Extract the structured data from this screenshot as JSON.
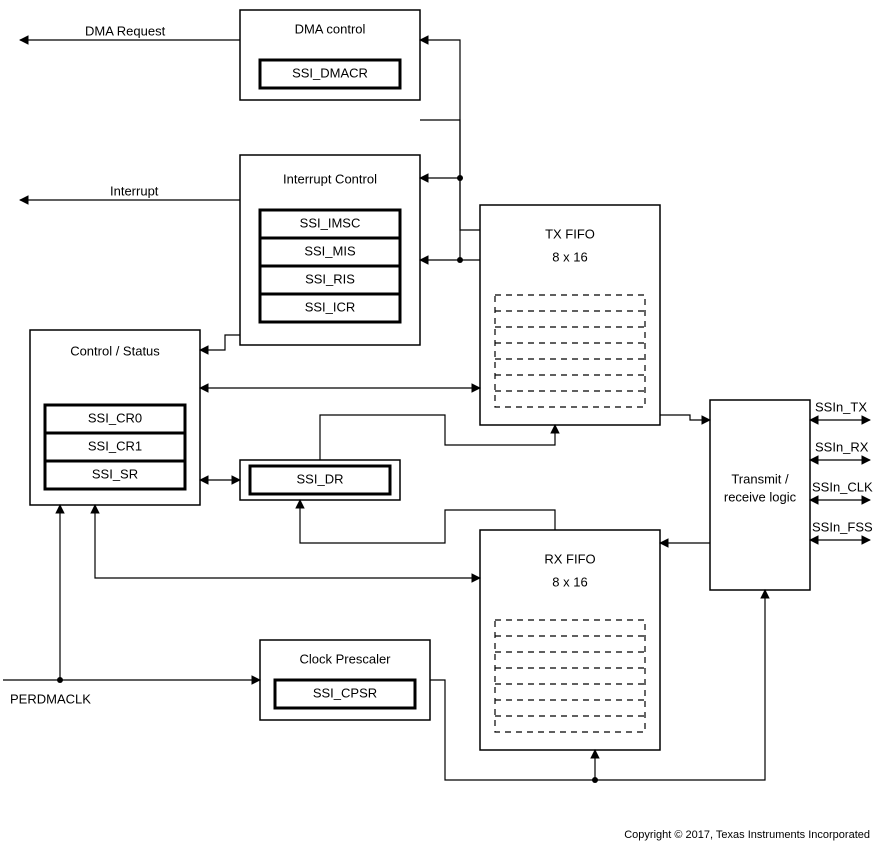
{
  "signals": {
    "dma_request": "DMA Request",
    "interrupt": "Interrupt",
    "perdmaclk": "PERDMACLK",
    "ssin_tx": "SSIn_TX",
    "ssin_rx": "SSIn_RX",
    "ssin_clk": "SSIn_CLK",
    "ssin_fss": "SSIn_FSS"
  },
  "blocks": {
    "dma": {
      "title": "DMA control",
      "regs": [
        "SSI_DMACR"
      ]
    },
    "interrupt": {
      "title": "Interrupt Control",
      "regs": [
        "SSI_IMSC",
        "SSI_MIS",
        "SSI_RIS",
        "SSI_ICR"
      ]
    },
    "control_status": {
      "title": "Control / Status",
      "regs": [
        "SSI_CR0",
        "SSI_CR1",
        "SSI_SR"
      ]
    },
    "data_reg": "SSI_DR",
    "clock_prescaler": {
      "title": "Clock Prescaler",
      "regs": [
        "SSI_CPSR"
      ]
    },
    "tx_fifo": {
      "title": "TX FIFO",
      "size": "8 x 16"
    },
    "rx_fifo": {
      "title": "RX FIFO",
      "size": "8 x 16"
    },
    "txrx_logic": {
      "line1": "Transmit /",
      "line2": "receive logic"
    }
  },
  "copyright": "Copyright © 2017, Texas Instruments Incorporated"
}
